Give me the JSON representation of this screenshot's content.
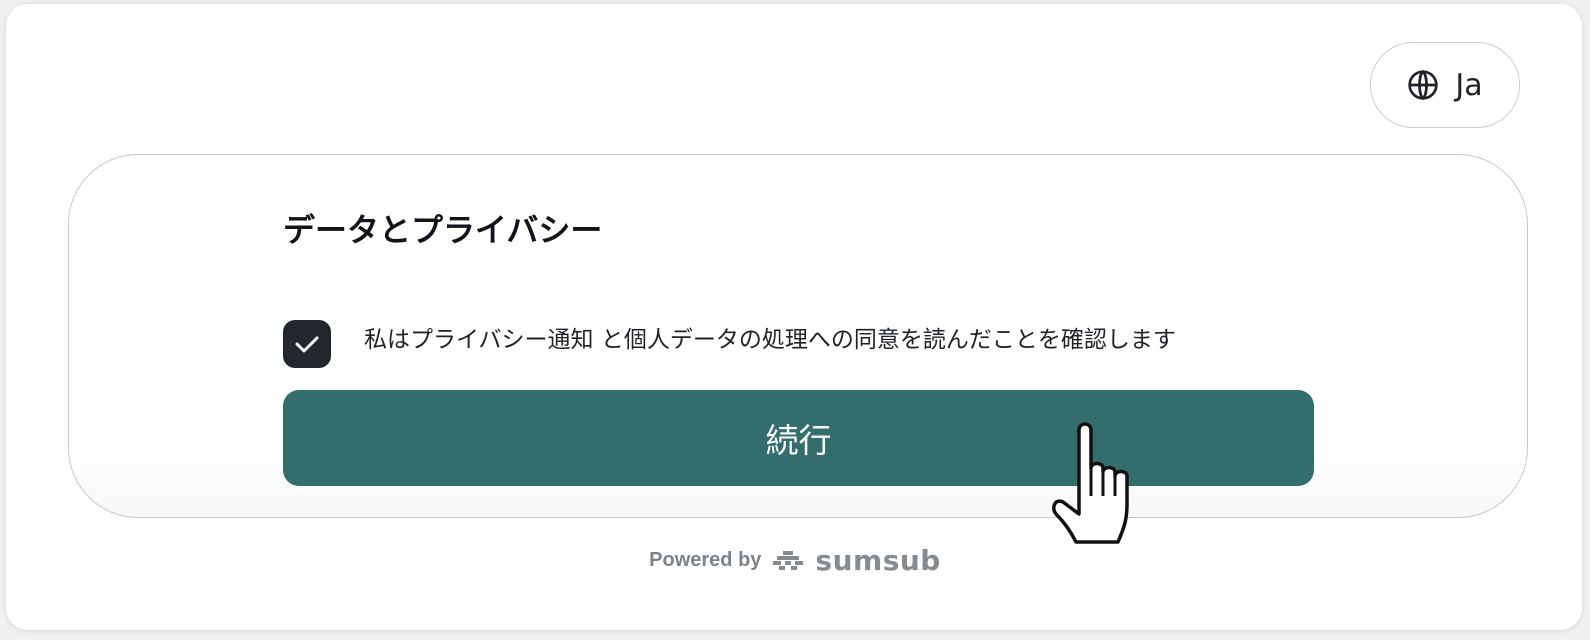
{
  "language_selector": {
    "icon": "globe-icon",
    "label": "Ja"
  },
  "card": {
    "title": "データとプライバシー",
    "consent": {
      "checked": true,
      "text": "私はプライバシー通知 と個人データの処理への同意を読んだことを確認します"
    },
    "continue_label": "続行"
  },
  "footer": {
    "powered_by": "Powered by",
    "brand": "sumsub",
    "brand_icon": "sumsub-logo-icon"
  },
  "colors": {
    "primary_button": "#336e6d",
    "checkbox_checked": "#23272d",
    "text": "#1f2327",
    "muted": "#7d8286"
  }
}
